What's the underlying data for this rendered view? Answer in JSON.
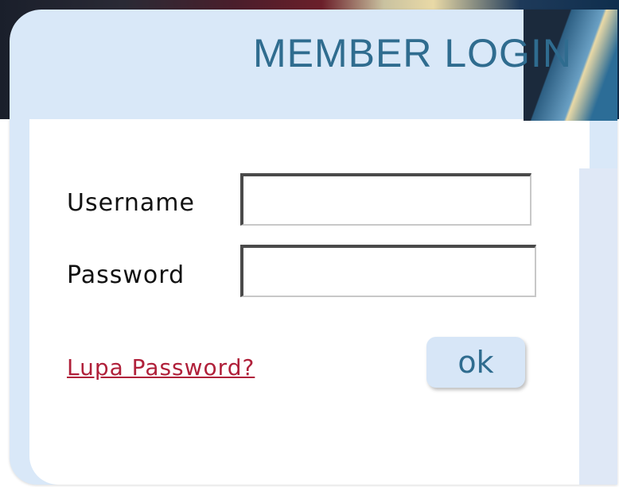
{
  "header": {
    "title": "MEMBER LOGIN"
  },
  "form": {
    "username_label": "Username",
    "username_value": "",
    "password_label": "Password",
    "password_value": "",
    "forgot_link": "Lupa Password?",
    "submit_label": "ok"
  },
  "colors": {
    "title": "#2f6c8f",
    "card_bg": "#d9e8f8",
    "link": "#b0203a"
  }
}
